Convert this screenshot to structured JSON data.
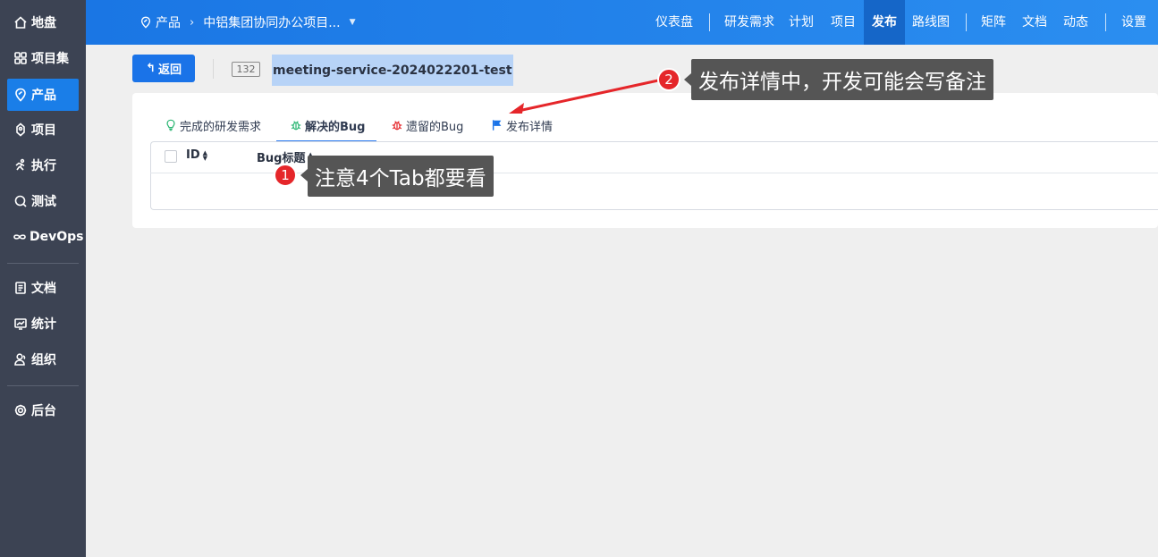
{
  "sidebar": {
    "items": [
      {
        "label": "地盘",
        "icon": "home-icon"
      },
      {
        "label": "项目集",
        "icon": "grid-icon"
      },
      {
        "label": "产品",
        "icon": "product-icon"
      },
      {
        "label": "项目",
        "icon": "project-icon"
      },
      {
        "label": "执行",
        "icon": "run-icon"
      },
      {
        "label": "测试",
        "icon": "test-icon"
      },
      {
        "label": "DevOps",
        "icon": "infinity-icon"
      },
      {
        "label": "文档",
        "icon": "doc-icon"
      },
      {
        "label": "统计",
        "icon": "chart-icon"
      },
      {
        "label": "组织",
        "icon": "people-icon"
      },
      {
        "label": "后台",
        "icon": "gear-icon"
      }
    ],
    "active": "产品"
  },
  "topbar": {
    "breadcrumb": {
      "root": "产品",
      "current": "中铝集团协同办公项目..."
    },
    "nav": [
      "仪表盘",
      "研发需求",
      "计划",
      "项目",
      "发布",
      "路线图",
      "矩阵",
      "文档",
      "动态",
      "设置"
    ],
    "active_nav": "发布"
  },
  "header": {
    "back_label": "返回",
    "release_id": "132",
    "release_title": "meeting-service-2024022201-test"
  },
  "tabs": [
    {
      "label": "完成的研发需求",
      "icon": "bulb-icon",
      "icon_color": "#2bb673"
    },
    {
      "label": "解决的Bug",
      "icon": "bug-icon",
      "icon_color": "#2bb673"
    },
    {
      "label": "遗留的Bug",
      "icon": "bug-icon",
      "icon_color": "#e5262a"
    },
    {
      "label": "发布详情",
      "icon": "flag-icon",
      "icon_color": "#1a73e8"
    }
  ],
  "active_tab": "解决的Bug",
  "table": {
    "columns": [
      "ID",
      "Bug标题"
    ]
  },
  "annotations": [
    {
      "number": "1",
      "text": "注意4个Tab都要看"
    },
    {
      "number": "2",
      "text": "发布详情中，开发可能会写备注"
    }
  ],
  "colors": {
    "accent": "#1a73e8",
    "sidebar_bg": "#3c4353",
    "annotation_red": "#e5262a",
    "callout_bg": "#555555"
  }
}
